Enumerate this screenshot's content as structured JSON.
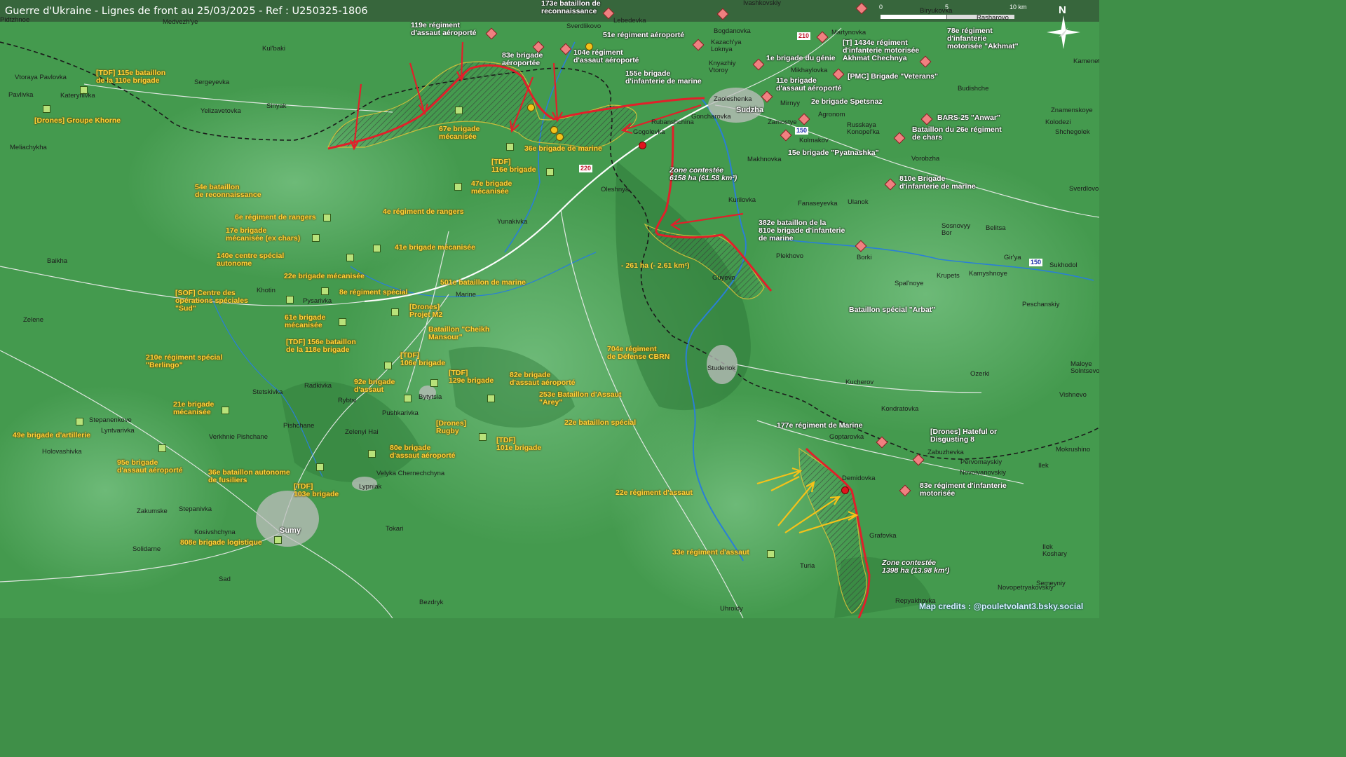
{
  "header": {
    "title": "Guerre d'Ukraine - Lignes de front au 25/03/2025 - Ref : U250325-1806"
  },
  "scale": {
    "ticks": [
      "0",
      "5",
      "10 km"
    ]
  },
  "north_label": "N",
  "icons": {
    "north_arrow": "compass-star-icon",
    "ua_unit": "ua-unit-symbol-icon",
    "ru_unit": "ru-unit-symbol-icon"
  },
  "colors": {
    "map_green": "#3f8f48",
    "ua_text": "#ffd23a",
    "ru_text": "#ffffff",
    "front_line": "#e1202a",
    "ua_arrow": "#f4c21a",
    "border": "#222222"
  },
  "zones": [
    {
      "id": "sudzha",
      "line1": "Zone contestée",
      "line2": "6158 ha (61.58 km²)"
    },
    {
      "id": "guyevo",
      "line1": "- 261 ha (- 2.61 km²)",
      "line2": ""
    },
    {
      "id": "grafovka",
      "line1": "Zone contestée",
      "line2": "1398 ha (13.98 km²)"
    }
  ],
  "ua_units": [
    "[TDF] 115e bataillon\nde la 110e brigade",
    "[Drones] Groupe Khorne",
    "67e brigade\nmécanisée",
    "[TDF]\n116e brigade",
    "36e brigade de marine",
    "47e brigade\nmécanisée",
    "54e bataillon\nde reconnaissance",
    "4e régiment de rangers",
    "6e régiment de rangers",
    "17e brigade\nmécanisée (ex chars)",
    "41e brigade mécanisée",
    "140e centre spécial\nautonome",
    "22e brigade mécanisée",
    "501e bataillon de marine",
    "[SOF] Centre des\nopérations spéciales\n\"Sud\"",
    "8e régiment spécial",
    "[Drones]\nProjet M2",
    "61e brigade\nmécanisée",
    "Bataillon \"Cheikh\nMansour\"",
    "[TDF] 156e bataillon\nde la 118e brigade",
    "[TDF]\n106e brigade",
    "210e régiment spécial\n\"Berlingo\"",
    "[TDF]\n129e brigade",
    "92e brigade\nd'assaut",
    "82e brigade\nd'assaut aéroporté",
    "253e Bataillon d'Assaut\n\"Arey\"",
    "21e brigade\nmécanisée",
    "49e brigade d'artillerie",
    "[Drones]\nRugby",
    "22e bataillon spécial",
    "[TDF]\n101e brigade",
    "80e brigade\nd'assaut aéroporté",
    "95e brigade\nd'assaut aéroporté",
    "36e bataillon autonome\nde fusiliers",
    "[TDF]\n103e brigade",
    "808e brigade logistique",
    "704e régiment\nde Défense CBRN",
    "22e régiment d'assaut",
    "33e régiment d'assaut"
  ],
  "ru_units": [
    "173e bataillon de\nreconnaissance",
    "119e régiment\nd'assaut aéroporté",
    "83e brigade\naéroportée",
    "104e régiment\nd'assaut aéroporté",
    "51e régiment aéroporté",
    "155e brigade\nd'infanterie de marine",
    "1e brigade du génie",
    "[T] 1434e régiment\nd'infanterie motorisée\nAkhmat Chechnya",
    "78e régiment\nd'infanterie\nmotorisée \"Akhmat\"",
    "11e brigade\nd'assaut aéroporté",
    "[PMC] Brigade \"Veterans\"",
    "2e brigade Spetsnaz",
    "BARS-25 \"Anwar\"",
    "Bataillon du 26e régiment\nde chars",
    "15e brigade \"Pyatnashka\"",
    "810e Brigade\nd'infanterie de marine",
    "382e bataillon de la\n810e brigade d'infanterie\nde marine",
    "Bataillon spécial \"Arbat\"",
    "177e régiment de Marine",
    "[Drones] Hateful or\nDisgusting 8",
    "83e régiment d'infanterie\nmotorisée"
  ],
  "towns": [
    "Medvezh'ye",
    "Sverdlikovo",
    "Lebedevka",
    "Ivashkovskiy",
    "Biryukovka",
    "Rasharovo",
    "Bogdanovka",
    "Martynovka",
    "Kazach'ya\nLoknya",
    "Knyazhiy\nVtoroy",
    "Mikhaylovka",
    "Zaoleshenka",
    "Sudzha",
    "Mirnyy",
    "Zamostye",
    "Agronom",
    "Russkaya\nKonopel'ka",
    "Kolmakov",
    "Makhnovka",
    "Vorobzha",
    "Rubanshchina",
    "Gogolevka",
    "Goncharovka",
    "Kamenets",
    "Budishche",
    "Znamenskoye",
    "Kolodezi",
    "Shchegolek",
    "Sverdlovo",
    "Vtoraya Pavlovka",
    "Pavlivka",
    "Katerynivka",
    "Sergeyevka",
    "Kul'baki",
    "Yelizavetovka",
    "Sinyak",
    "Meliachykha",
    "Oleshnya",
    "Kurilovka",
    "Fanaseyevka",
    "Ulanok",
    "Sosnovyy\nBor",
    "Belitsa",
    "Gir'ya",
    "Yunakivka",
    "Plekhovo",
    "Borki",
    "Krupets",
    "Kamyshnoye",
    "Sukhodol",
    "Spal'noye",
    "Guyevo",
    "Peschanskiy",
    "Baikha",
    "Zelene",
    "Khotin",
    "Pysarivka",
    "Marine",
    "Studenok",
    "Kucherov",
    "Ozerki",
    "Maloye\nSolntsevo",
    "Vishnevo",
    "Stepanenkove",
    "Lyntvarivka",
    "Holovashivka",
    "Radkivka",
    "Stetskivka",
    "Rybtsi",
    "Bytytsia",
    "Pushkarivka",
    "Pishchane",
    "Zelenyi Hai",
    "Verkhnie Pishchane",
    "Kondratovka",
    "Goptarovka",
    "Zabuzhevka",
    "Pervomayskiy",
    "Novoivanovskiy",
    "Ilek",
    "Mokrushino",
    "Demidovka",
    "Grafovka",
    "Ilek\nKoshary",
    "Semeyniy",
    "Turia",
    "Novopetryakovskiy",
    "Repyakhovka",
    "Uhroidy",
    "Bezdryk",
    "Tokari",
    "Lypniak",
    "Velyka Chernechchyna",
    "Zakumske",
    "Stepanivka",
    "Kosivshchyna",
    "Solidarne",
    "Sad",
    "Sumy",
    "Pidtzhnoe"
  ],
  "roads": [
    {
      "label": "210",
      "color": "red"
    },
    {
      "label": "150",
      "color": "blue"
    },
    {
      "label": "220",
      "color": "red"
    },
    {
      "label": "150",
      "color": "blue"
    }
  ],
  "credits": "Map credits : @pouletvolant3.bsky.social"
}
